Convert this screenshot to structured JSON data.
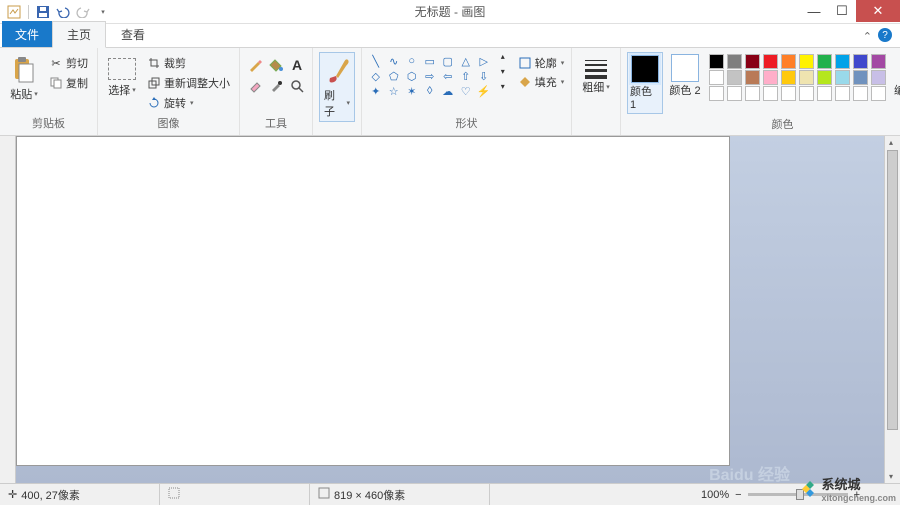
{
  "window": {
    "title": "无标题 - 画图"
  },
  "tabs": {
    "file": "文件",
    "home": "主页",
    "view": "查看"
  },
  "clipboard": {
    "paste": "粘贴",
    "cut": "剪切",
    "copy": "复制",
    "label": "剪贴板"
  },
  "image": {
    "select": "选择",
    "crop": "裁剪",
    "resize": "重新调整大小",
    "rotate": "旋转",
    "label": "图像"
  },
  "tools": {
    "label": "工具"
  },
  "brushes": {
    "label": "刷子"
  },
  "shapes": {
    "outline": "轮廓",
    "fill": "填充",
    "label": "形状"
  },
  "size": {
    "label": "粗细"
  },
  "colors": {
    "c1": "颜色 1",
    "c2": "颜色 2",
    "edit": "编辑颜色",
    "label": "颜色",
    "palette": [
      "#000000",
      "#7f7f7f",
      "#880015",
      "#ed1c24",
      "#ff7f27",
      "#fff200",
      "#22b14c",
      "#00a2e8",
      "#3f48cc",
      "#a349a4",
      "#ffffff",
      "#c3c3c3",
      "#b97a57",
      "#ffaec9",
      "#ffc90e",
      "#efe4b0",
      "#b5e61d",
      "#99d9ea",
      "#7092be",
      "#c8bfe7",
      "#ffffff",
      "#ffffff",
      "#ffffff",
      "#ffffff",
      "#ffffff",
      "#ffffff",
      "#ffffff",
      "#ffffff",
      "#ffffff",
      "#ffffff"
    ]
  },
  "status": {
    "pos": "400, 27像素",
    "sel": "",
    "dim": "819 × 460像素",
    "zoom": "100%"
  },
  "watermark": {
    "brand": "系统城",
    "url": "xitongcheng.com",
    "bg": "Baidu 经验"
  }
}
